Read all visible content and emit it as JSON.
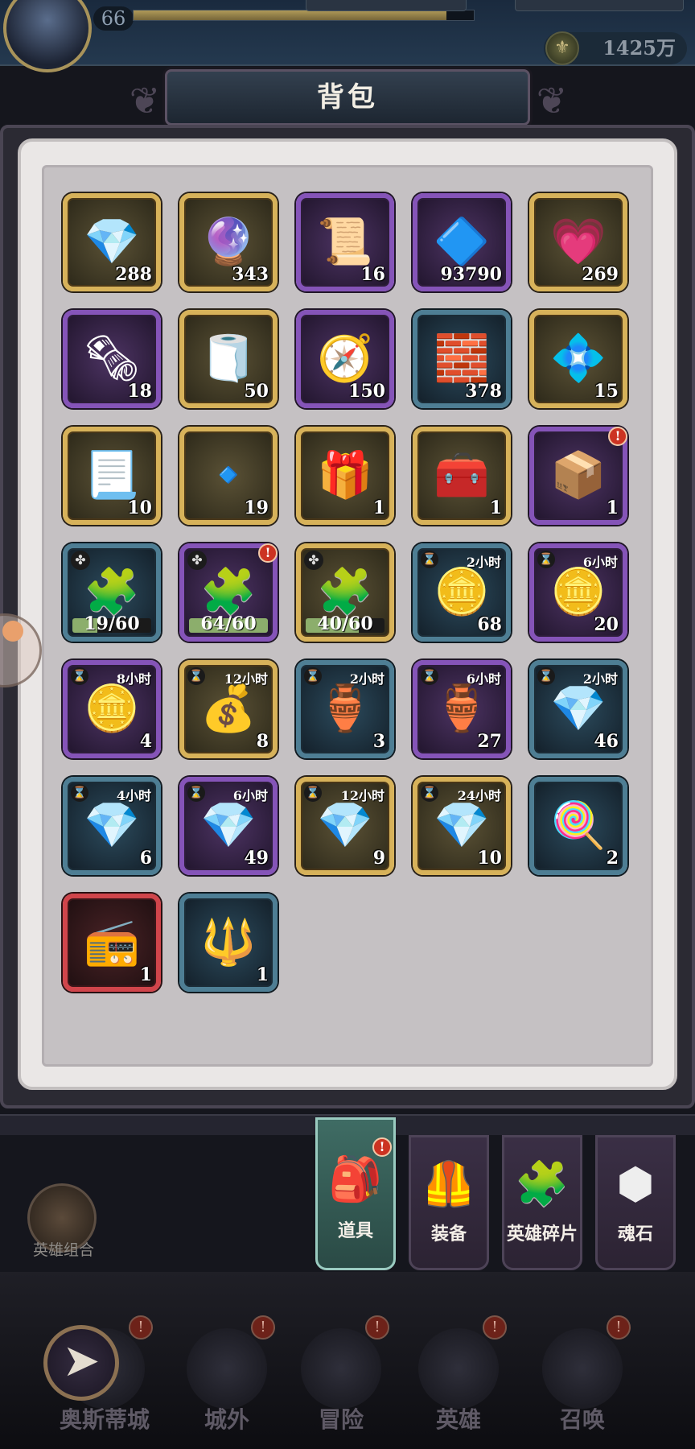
{
  "header": {
    "level": "66",
    "gold": "1425万",
    "title": "背包"
  },
  "items": [
    {
      "icon": "💎",
      "count": "288",
      "rarity": "gold",
      "icon_name": "cyan-crystal-icon"
    },
    {
      "icon": "🔮",
      "count": "343",
      "rarity": "gold",
      "icon_name": "teal-orb-icon"
    },
    {
      "icon": "📜",
      "count": "16",
      "rarity": "purple",
      "icon_name": "scroll-icon"
    },
    {
      "icon": "🔷",
      "count": "93790",
      "rarity": "purple",
      "icon_name": "blue-gem-icon"
    },
    {
      "icon": "💗",
      "count": "269",
      "rarity": "gold",
      "icon_name": "pink-crystal-icon"
    },
    {
      "icon": "🗞",
      "count": "18",
      "rarity": "purple",
      "icon_name": "rolled-scroll-icon"
    },
    {
      "icon": "🧻",
      "count": "50",
      "rarity": "gold",
      "icon_name": "gold-scroll-icon"
    },
    {
      "icon": "🧭",
      "count": "150",
      "rarity": "purple",
      "icon_name": "compass-icon"
    },
    {
      "icon": "🧱",
      "count": "378",
      "rarity": "blue",
      "icon_name": "iron-ingot-icon"
    },
    {
      "icon": "💠",
      "count": "15",
      "rarity": "gold",
      "icon_name": "swirl-crystal-icon"
    },
    {
      "icon": "📃",
      "count": "10",
      "rarity": "gold",
      "icon_name": "purple-scroll-icon"
    },
    {
      "icon": "🔹",
      "count": "19",
      "rarity": "gold",
      "icon_name": "purple-shard-icon"
    },
    {
      "icon": "🎁",
      "count": "1",
      "rarity": "gold",
      "icon_name": "green-chest-icon"
    },
    {
      "icon": "🧰",
      "count": "1",
      "rarity": "gold",
      "icon_name": "red-chest-icon"
    },
    {
      "icon": "📦",
      "count": "1",
      "rarity": "purple",
      "icon_name": "silver-chest-icon",
      "badge": "!"
    },
    {
      "icon": "🧩",
      "rarity": "blue",
      "icon_name": "blue-puzzle-icon",
      "progress": "19/60",
      "fill": 0.32
    },
    {
      "icon": "🧩",
      "rarity": "purple",
      "icon_name": "purple-puzzle-icon",
      "progress": "64/60",
      "fill": 1.0,
      "badge": "!"
    },
    {
      "icon": "🧩",
      "rarity": "gold",
      "icon_name": "gold-puzzle-icon",
      "progress": "40/60",
      "fill": 0.67
    },
    {
      "icon": "🪙",
      "count": "68",
      "rarity": "blue",
      "icon_name": "gold-coins-icon",
      "timer": "2小时"
    },
    {
      "icon": "🪙",
      "count": "20",
      "rarity": "purple",
      "icon_name": "gold-coins-icon",
      "timer": "6小时"
    },
    {
      "icon": "🪙",
      "count": "4",
      "rarity": "purple",
      "icon_name": "gold-coins-icon",
      "timer": "8小时"
    },
    {
      "icon": "💰",
      "count": "8",
      "rarity": "gold",
      "icon_name": "treasure-chest-coins-icon",
      "timer": "12小时"
    },
    {
      "icon": "🏺",
      "count": "3",
      "rarity": "blue",
      "icon_name": "red-crate-icon",
      "timer": "2小时"
    },
    {
      "icon": "🏺",
      "count": "27",
      "rarity": "purple",
      "icon_name": "red-crate-icon",
      "timer": "6小时"
    },
    {
      "icon": "💎",
      "count": "46",
      "rarity": "blue",
      "icon_name": "blue-gems-icon",
      "timer": "2小时"
    },
    {
      "icon": "💎",
      "count": "6",
      "rarity": "blue",
      "icon_name": "blue-gems-icon",
      "timer": "4小时"
    },
    {
      "icon": "💎",
      "count": "49",
      "rarity": "purple",
      "icon_name": "blue-gems-pile-icon",
      "timer": "6小时"
    },
    {
      "icon": "💎",
      "count": "9",
      "rarity": "gold",
      "icon_name": "gem-treasure-chest-icon",
      "timer": "12小时"
    },
    {
      "icon": "💎",
      "count": "10",
      "rarity": "gold",
      "icon_name": "gem-treasure-chest-icon",
      "timer": "24小时"
    },
    {
      "icon": "🍭",
      "count": "2",
      "rarity": "blue",
      "icon_name": "lollipop-icon"
    },
    {
      "icon": "📻",
      "count": "1",
      "rarity": "red",
      "icon_name": "gramophone-icon"
    },
    {
      "icon": "🔱",
      "count": "1",
      "rarity": "blue",
      "icon_name": "rune-stone-icon"
    }
  ],
  "tabs": [
    {
      "label": "道具",
      "icon": "🎒",
      "badge": "!",
      "active": true
    },
    {
      "label": "装备",
      "icon": "🦺"
    },
    {
      "label": "英雄碎片",
      "icon": "🧩"
    },
    {
      "label": "魂石",
      "icon": "⬢"
    }
  ],
  "side": {
    "hero_combo": "英雄组合"
  },
  "bottom_nav": [
    {
      "label": "奥斯蒂城",
      "badge": "!"
    },
    {
      "label": "城外",
      "badge": "!"
    },
    {
      "label": "冒险",
      "badge": "!"
    },
    {
      "label": "英雄",
      "badge": "!"
    },
    {
      "label": "召唤",
      "badge": "!"
    }
  ],
  "icons": {
    "back": "back-arrow-icon",
    "hourglass": "⌛",
    "puzzle": "✤",
    "coin": "⚜"
  }
}
